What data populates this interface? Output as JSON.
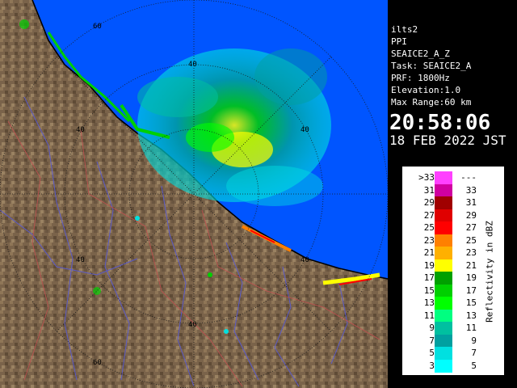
{
  "station": {
    "name": "ilts2",
    "scan_type": "PPI",
    "product": "SEAICE2_A_Z",
    "task": "Task: SEAICE2_A",
    "prf": "PRF: 1800Hz",
    "elevation": "Elevation:1.0",
    "max_range": "Max Range:60 km",
    "time": "20:58:06",
    "date": "18 FEB 2022 JST"
  },
  "legend": {
    "unit_label": "Reflectivity in dBZ",
    "rows": [
      {
        "lo": ">33",
        "hi": "---",
        "color": "#ff40ff"
      },
      {
        "lo": "31",
        "hi": "33",
        "color": "#d000a0"
      },
      {
        "lo": "29",
        "hi": "31",
        "color": "#a00000"
      },
      {
        "lo": "27",
        "hi": "29",
        "color": "#e00000"
      },
      {
        "lo": "25",
        "hi": "27",
        "color": "#ff0000"
      },
      {
        "lo": "23",
        "hi": "25",
        "color": "#ff8000"
      },
      {
        "lo": "21",
        "hi": "23",
        "color": "#ffb000"
      },
      {
        "lo": "19",
        "hi": "21",
        "color": "#ffff00"
      },
      {
        "lo": "17",
        "hi": "19",
        "color": "#00a000"
      },
      {
        "lo": "15",
        "hi": "17",
        "color": "#00d000"
      },
      {
        "lo": "13",
        "hi": "15",
        "color": "#00ff00"
      },
      {
        "lo": "11",
        "hi": "13",
        "color": "#00ff80"
      },
      {
        "lo": "9",
        "hi": "11",
        "color": "#00c0a0"
      },
      {
        "lo": "7",
        "hi": "9",
        "color": "#00a0a0"
      },
      {
        "lo": "5",
        "hi": "7",
        "color": "#00e0e0"
      },
      {
        "lo": "3",
        "hi": "5",
        "color": "#00ffff"
      }
    ]
  },
  "map": {
    "range_labels": [
      "60",
      "40",
      "40",
      "40",
      "40",
      "40",
      "60"
    ],
    "colors": {
      "sea": "#0055ff",
      "land": "#7a634a",
      "coast": "#000000",
      "rings": "#1a1a1a",
      "rivers": "#5a5ac8"
    }
  }
}
